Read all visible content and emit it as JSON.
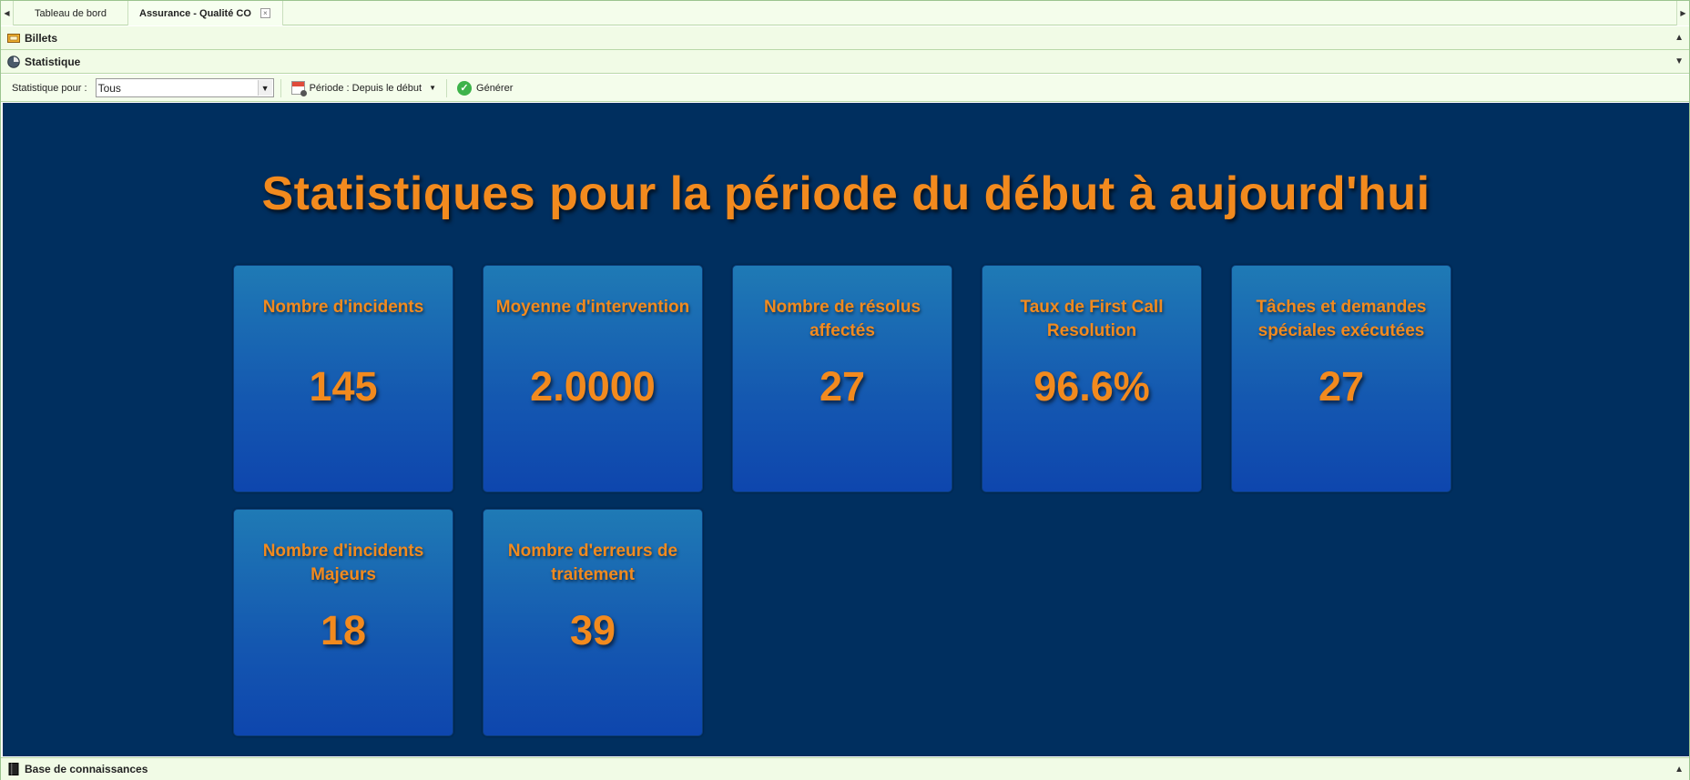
{
  "tabs": {
    "items": [
      {
        "label": "Tableau de bord"
      },
      {
        "label": "Assurance - Qualité CO"
      }
    ],
    "close_glyph": "×"
  },
  "panels": {
    "billets": {
      "label": "Billets",
      "icon": "ticket-icon"
    },
    "statistique": {
      "label": "Statistique",
      "icon": "chart-icon"
    },
    "base_connaissances": {
      "label": "Base de connaissances",
      "icon": "book-icon"
    }
  },
  "toolbar": {
    "statistique_pour_label": "Statistique pour :",
    "statistique_pour_value": "Tous",
    "periode_label": "Période : Depuis le début",
    "generer_label": "Générer"
  },
  "dashboard": {
    "title": "Statistiques pour la période du début à aujourd'hui",
    "cards": [
      {
        "label": "Nombre d'incidents",
        "value": "145"
      },
      {
        "label": "Moyenne d'intervention",
        "value": "2.0000"
      },
      {
        "label": "Nombre de résolus affectés",
        "value": "27"
      },
      {
        "label": "Taux de First Call Resolution",
        "value": "96.6%"
      },
      {
        "label": "Tâches et demandes spéciales exécutées",
        "value": "27"
      },
      {
        "label": "Nombre d'incidents Majeurs",
        "value": "18"
      },
      {
        "label": "Nombre d'erreurs de traitement",
        "value": "39"
      }
    ]
  },
  "colors": {
    "accent_orange": "#f28a1e",
    "dashboard_bg": "#002f5f",
    "card_blue": "#1457b0",
    "chrome_green": "#f4fdeb"
  }
}
